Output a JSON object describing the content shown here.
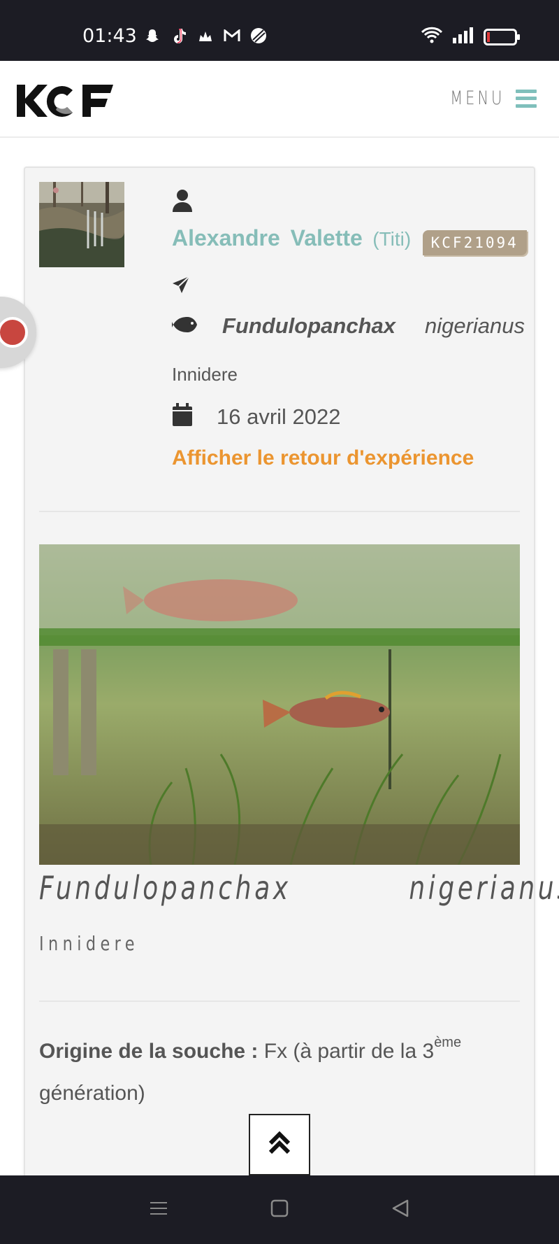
{
  "status_bar": {
    "time": "01:43",
    "app_icons": [
      "snapchat-icon",
      "tiktok-icon",
      "app-icon",
      "gmail-icon",
      "sport-icon"
    ],
    "system_icons": [
      "wifi-icon",
      "signal-icon",
      "battery-icon"
    ]
  },
  "header": {
    "logo_text": "KCF",
    "menu_label": "MENU"
  },
  "card": {
    "breeder": {
      "name": "Alexandre Valette",
      "nickname": "(Titi)",
      "member_id": "KCF21094"
    },
    "species": {
      "genus": "Fundulopanchax",
      "epithet": "nigerianus",
      "locality": "Innidere"
    },
    "date": "16 avril 2022",
    "feedback_link": "Afficher le retour d'expérience",
    "caption": {
      "genus": "Fundulopanchax",
      "epithet": "nigerianus",
      "locality": "Innidere"
    },
    "origin": {
      "label": "Origine de la souche :",
      "value_prefix": "Fx (à partir de la 3",
      "value_sup": "ème",
      "value_suffix": "génération)"
    }
  },
  "colors": {
    "accent_teal": "#86bdb8",
    "link_orange": "#eb9530",
    "badge": "#b0a089",
    "bars": "#1c1c24"
  }
}
